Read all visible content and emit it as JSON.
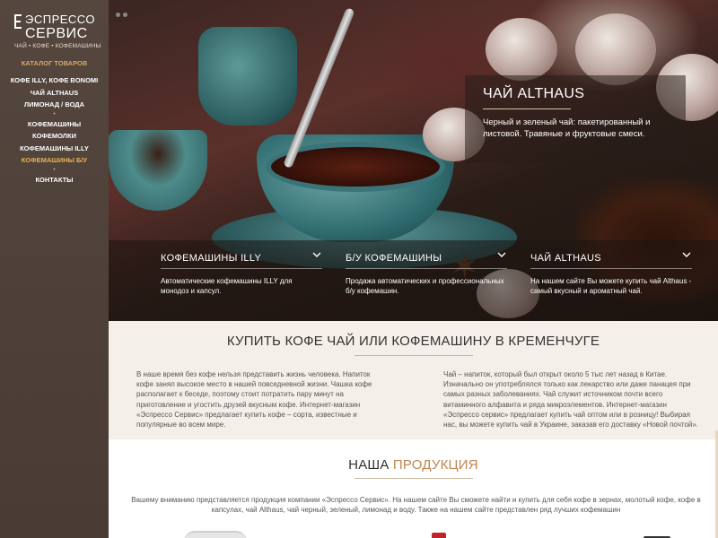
{
  "brand": {
    "line1": "ЭСПРЕССО",
    "line2": "СЕРВИС",
    "tagline": "ЧАЙ • КОФЕ • КОФЕМАШИНЫ"
  },
  "sidebar": {
    "catalog_label": "КАТАЛОГ ТОВАРОВ",
    "items": [
      {
        "label": "КОФЕ ILLY, КОФЕ BONOMI"
      },
      {
        "label": "ЧАЙ ALTHAUS"
      },
      {
        "label": "ЛИМОНАД / ВОДА"
      },
      {
        "label": "КОФЕМАШИНЫ"
      },
      {
        "label": "КОФЕМОЛКИ"
      },
      {
        "label": "КОФЕМАШИНЫ ILLY"
      },
      {
        "label": "КОФЕМАШИНЫ Б/У"
      },
      {
        "label": "КОНТАКТЫ"
      }
    ],
    "separator": "•"
  },
  "hero": {
    "feature": {
      "title": "ЧАЙ ALTHAUS",
      "text": "Черный и зеленый чай: пакетированный и листовой. Травяные и фруктовые смеси."
    },
    "strip": [
      {
        "title": "КОФЕМАШИНЫ ILLY",
        "text": "Автоматические кофемашины ILLY для монодоз и капсул."
      },
      {
        "title": "Б/У КОФЕМАШИНЫ",
        "text": "Продажа автоматических и профессиональных б/у кофемашин."
      },
      {
        "title": "ЧАЙ ALTHAUS",
        "text": "На нашем сайте Вы можете купить чай Althaus - самый вкусный и ароматный чай."
      }
    ]
  },
  "about": {
    "title": "КУПИТЬ КОФЕ ЧАЙ ИЛИ КОФЕМАШИНУ В КРЕМЕНЧУГЕ",
    "left": "В наше время без кофе нельзя представить жизнь человека. Напиток кофе занял высокое место в нашей повседневной жизни. Чашка кофе располагает к беседе, поэтому стоит потратить пару минут на приготовление и угостить друзей вкусным кофе. Интернет-магазин «Эспрессо Сервис» предлагает купить кофе – сорта, известные и популярные во всем мире.",
    "right": "Чай – напиток, который был открыт около 5 тыс лет назад в Китае. Изначально он употреблялся только как лекарство или даже панацея при самых разных заболеваниях. Чай служит источником почти всего витаминного алфавита и ряда микроэлементов. Интернет-магазин «Эспрессо сервис» предлагает купить чай оптом или в розницу! Выбирая нас, вы можете купить чай в Украине, заказав его доставку «Новой почтой»."
  },
  "products": {
    "title_plain": "НАША",
    "title_accent": "ПРОДУКЦИЯ",
    "text": "Вашему вниманию представляется продукция компании «Эспрессо Сервис». На нашем сайте Вы сможете найти и купить для себя кофе в зернах, молотый кофе, кофе в капсулах, чай Althaus, чай черный, зеленый, лимонад и воду. Также на нашем сайте представлен ряд лучших кофемашин"
  },
  "colors": {
    "sidebar_bg": "#4f423a",
    "accent_gold": "#d9a66b",
    "active_item": "#e6b25c",
    "title_accent": "#c08650"
  }
}
